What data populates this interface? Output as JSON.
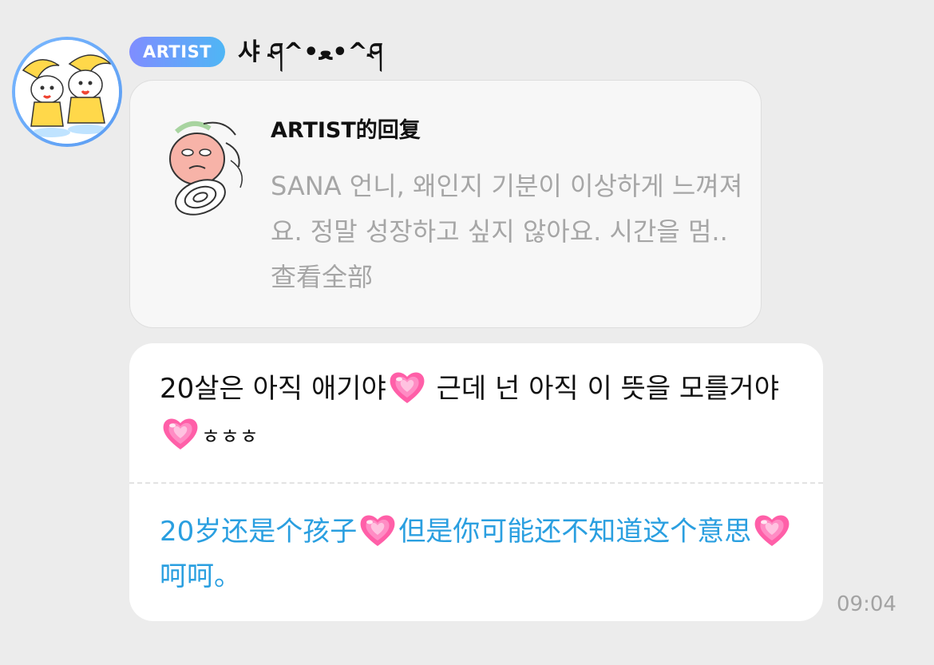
{
  "header": {
    "badge_label": "ARTIST",
    "username": "샤 ཤ^•ﻌ•^ཤ"
  },
  "reply": {
    "title": "ARTIST的回复",
    "text": "SANA 언니, 왜인지 기분이 이상하게 느껴져요. 정말 성장하고 싶지 않아요. 시간을 멈..",
    "view_all": "查看全部"
  },
  "message": {
    "original_part1": "20살은 아직 애기야",
    "original_part2": " 근데 넌 아직 이 뜻을 모를거야",
    "original_part3": "ㅎㅎㅎ",
    "translation_part1": "20岁还是个孩子",
    "translation_part2": "但是你可能还不知道这个意思",
    "translation_part3": "呵呵。",
    "heart_icon": "sparkling-heart-emoji",
    "timestamp": "09:04"
  },
  "colors": {
    "background": "#ececec",
    "badge_gradient_start": "#7f8dff",
    "badge_gradient_end": "#4fb6f5",
    "translation_text": "#2a9fe0",
    "muted_text": "#a6a6a6"
  }
}
